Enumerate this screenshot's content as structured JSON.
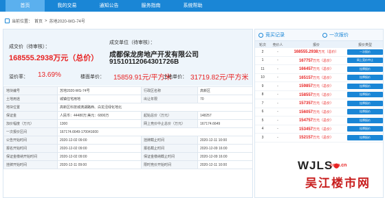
{
  "nav": [
    "首页",
    "我的交易",
    "通知公告",
    "服务指南",
    "系统帮助"
  ],
  "breadcrumb": {
    "prefix": "当前位置：",
    "home": "首页",
    "sep": ">",
    "current": "苏地2020-WG-74号"
  },
  "summary": {
    "price_label": "成交价（待审核）：",
    "price_value": "168555.2938万元（总价）",
    "buyer_label": "成交单位（待审核）：",
    "buyer_name": "成都保龙房地产开发有限公司",
    "buyer_code": "91510112064301726B",
    "premium_label": "溢价率：",
    "premium_value": "13.69%",
    "floor_label": "楼面单价：",
    "floor_value": "15859.91元/平方米",
    "land_label": "土地单价：",
    "land_value": "31719.82元/平方米"
  },
  "table": [
    [
      "地块编号",
      "苏地2020-WG-74号",
      "行政区名称",
      "高新区"
    ],
    [
      "土地用途",
      "城镇住宅用地",
      "出让年限",
      "70"
    ],
    [
      "地块位置",
      "高新区科技城漓湖路西、白龙泾绿化地北",
      "",
      ""
    ],
    [
      "保证金",
      "人民币：44480万;美元：6800万",
      "起始总价（万元）",
      "148257"
    ],
    [
      "加价幅度（万元）",
      "1300",
      "网上竞价中止总价（万元）",
      "167174.6649"
    ],
    [
      "一次报价区间",
      "167174.6649-170041600",
      "",
      ""
    ],
    [
      "公告开始时间",
      "2020-12-02 09:00",
      "挂牌截止时间",
      "2020-12-11 10:00"
    ],
    [
      "报名开始时间",
      "2020-12-02 09:00",
      "报名截止时间",
      "2020-12-09 16:00"
    ],
    [
      "保证金缴纳开始时间",
      "2020-12-02 09:00",
      "保证金缴纳截止时间",
      "2020-12-09 16:00"
    ],
    [
      "挂牌开始时间",
      "2020-12-11 09:00",
      "限时竞价开始时间",
      "2020-12-11 10:00"
    ]
  ],
  "right": {
    "tab1": "竞买记录",
    "tab2": "一次报价",
    "cols": [
      "轮次",
      "竞价人",
      "报价",
      "报价类型"
    ],
    "rows": [
      {
        "round": "2",
        "bidder": "-",
        "price": "168555.2938",
        "unit": "万元（总价）",
        "tag": "一次报价"
      },
      {
        "round": "1",
        "bidder": "-",
        "price": "167757",
        "unit": "万元（总价）",
        "tag": "网上竞价中止"
      },
      {
        "round": "11",
        "bidder": "-",
        "price": "166457",
        "unit": "万元（总价）",
        "tag": "挂牌报价"
      },
      {
        "round": "10",
        "bidder": "-",
        "price": "165157",
        "unit": "万元（总价）",
        "tag": "挂牌报价"
      },
      {
        "round": "9",
        "bidder": "-",
        "price": "159857",
        "unit": "万元（总价）",
        "tag": "挂牌报价"
      },
      {
        "round": "8",
        "bidder": "-",
        "price": "158557",
        "unit": "万元（总价）",
        "tag": "挂牌报价"
      },
      {
        "round": "7",
        "bidder": "-",
        "price": "157357",
        "unit": "万元（总价）",
        "tag": "挂牌报价"
      },
      {
        "round": "6",
        "bidder": "-",
        "price": "156057",
        "unit": "万元（总价）",
        "tag": "挂牌报价"
      },
      {
        "round": "5",
        "bidder": "-",
        "price": "154757",
        "unit": "万元（总价）",
        "tag": "挂牌报价"
      },
      {
        "round": "4",
        "bidder": "-",
        "price": "153457",
        "unit": "万元（总价）",
        "tag": "挂牌报价"
      },
      {
        "round": "3",
        "bidder": "-",
        "price": "152157",
        "unit": "万元（总价）",
        "tag": "挂牌报价"
      }
    ]
  },
  "watermark": {
    "text": "WJLS",
    "dot": "●",
    "domain": ".com.cn",
    "cn": "吴江楼市网"
  }
}
